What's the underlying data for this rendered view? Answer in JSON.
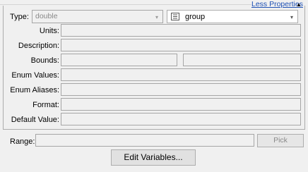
{
  "header": {
    "less_properties_label": "Less Properties",
    "arrow_glyph": "▲"
  },
  "type_row": {
    "label": "Type:",
    "type_value": "double",
    "group_value": "group",
    "dropdown_glyph": "▾"
  },
  "fields": {
    "units_label": "Units:",
    "description_label": "Description:",
    "bounds_label": "Bounds:",
    "enum_values_label": "Enum Values:",
    "enum_aliases_label": "Enum Aliases:",
    "format_label": "Format:",
    "default_value_label": "Default Value:"
  },
  "range": {
    "label": "Range:",
    "pick_label": "Pick"
  },
  "footer": {
    "edit_variables_label": "Edit Variables..."
  },
  "colors": {
    "link": "#1e50b4",
    "field_border": "#a6a6a6",
    "background": "#f0f0f0"
  }
}
